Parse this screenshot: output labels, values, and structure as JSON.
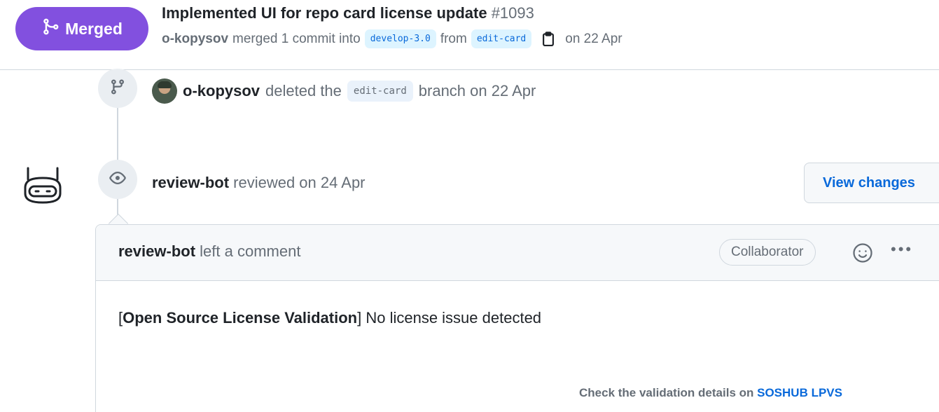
{
  "header": {
    "state_label": "Merged",
    "title": "Implemented UI for repo card license update",
    "number": "#1093",
    "author": "o-kopysov",
    "merge_text": "merged 1 commit into",
    "base_branch": "develop-3.0",
    "from_text": "from",
    "head_branch": "edit-card",
    "date_text": "on 22 Apr"
  },
  "timeline": {
    "branch_event": {
      "actor": "o-kopysov",
      "text_before": "deleted the",
      "branch": "edit-card",
      "text_after": "branch on 22 Apr"
    },
    "review_event": {
      "actor": "review-bot",
      "text": "reviewed on 24 Apr",
      "view_changes_label": "View changes"
    }
  },
  "comment": {
    "author": "review-bot",
    "action": "left a comment",
    "role_badge": "Collaborator",
    "more_label": "•••",
    "body_open": "[",
    "body_bold": "Open Source License Validation",
    "body_rest": "] No license issue detected",
    "footer_text": "Check the validation details on",
    "footer_link": "SOSHUB LPVS"
  },
  "colors": {
    "merged": "#8250df",
    "link": "#0969da",
    "muted": "#656d76",
    "border": "#d0d7de"
  },
  "icons": [
    "git-merge-icon",
    "copy-icon",
    "git-branch-icon",
    "eye-icon",
    "bot-avatar-icon",
    "smiley-icon",
    "kebab-icon"
  ]
}
